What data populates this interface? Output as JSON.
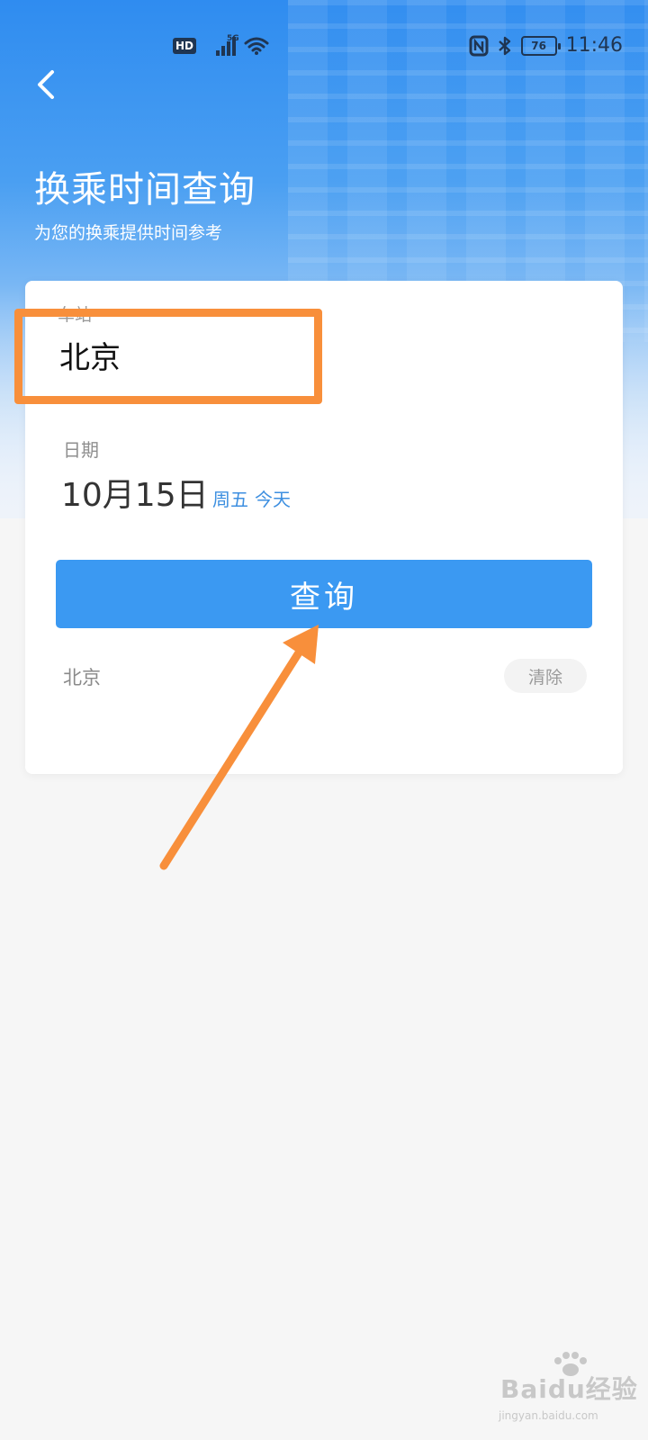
{
  "status_bar": {
    "hd_label": "HD",
    "network_label": "5G",
    "battery_level": "76",
    "time": "11:46",
    "icons": [
      "hd-icon",
      "signal-icon",
      "wifi-icon",
      "nfc-icon",
      "bluetooth-icon",
      "battery-icon"
    ]
  },
  "header": {
    "title": "换乘时间查询",
    "subtitle": "为您的换乘提供时间参考"
  },
  "form": {
    "station_label": "车站",
    "station_value": "北京",
    "date_label": "日期",
    "date_value": "10月15日",
    "weekday": "周五",
    "today": "今天",
    "query_button": "查询"
  },
  "history": {
    "items": [
      "北京"
    ],
    "clear_label": "清除"
  },
  "annotations": {
    "highlight_color": "#f88f3b",
    "arrow_color": "#f88f3b"
  },
  "watermark": {
    "text": "Baidu经验",
    "url": "jingyan.baidu.com"
  },
  "colors": {
    "primary": "#3b99f2",
    "accent_text": "#3d8fe0"
  }
}
